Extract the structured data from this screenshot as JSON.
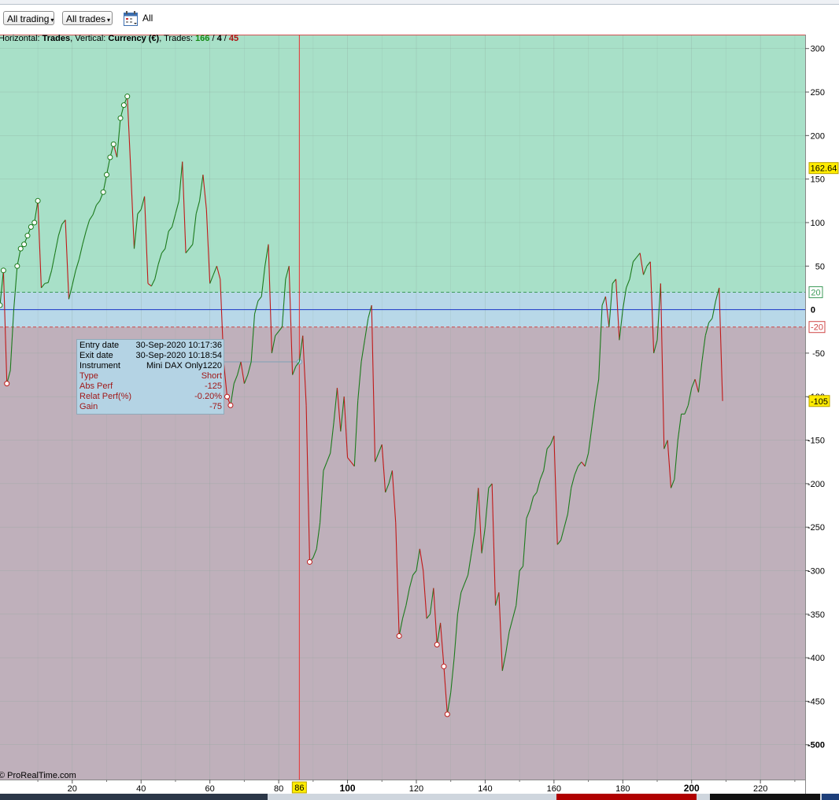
{
  "toolbar": {
    "trading_filter": "All trading",
    "trades_filter": "All trades",
    "period_label": "All"
  },
  "header": {
    "prefix": "Horizontal: ",
    "h_value": "Trades",
    "mid": ", Vertical: ",
    "v_value": "Currency (€)",
    "trades_label": ", Trades: ",
    "trades_win": "166",
    "sep1": " / ",
    "trades_flat": "4",
    "sep2": " / ",
    "trades_loss": "45"
  },
  "watermark": "© ProRealTime.com",
  "colors": {
    "profit_zone": "#a8e0c8",
    "neutral_zone": "#b8d8e8",
    "loss_zone": "#bfb0bb",
    "rising_segment": "#1c7a1c",
    "falling_segment": "#c01818",
    "cursor_line": "#e83030",
    "zero_line": "#1a35c8",
    "highlight_label": "#ffec00"
  },
  "chart_data": {
    "type": "line",
    "xlabel": "",
    "ylabel": "",
    "xlim": [
      -1,
      233
    ],
    "ylim": [
      -540,
      316
    ],
    "x_ticks": [
      20,
      40,
      60,
      80,
      100,
      120,
      140,
      160,
      180,
      200,
      220
    ],
    "x_ticks_bold": [
      100,
      200
    ],
    "y_ticks": [
      300,
      250,
      200,
      150,
      100,
      50,
      -50,
      -100,
      -150,
      -200,
      -250,
      -300,
      -350,
      -400,
      -450,
      -500
    ],
    "y_tick_zero": "0",
    "bands": {
      "upper": 20,
      "lower": -20,
      "upper_label": "20",
      "lower_label": "-20"
    },
    "last_value_label": "162.64",
    "last_value": 162.64,
    "current_value_label": "-105",
    "current_value": -105,
    "cursor_label": "86",
    "cursor_x": 86,
    "series": [
      {
        "values": [
          [
            -1,
            5
          ],
          [
            0,
            45
          ],
          [
            1,
            -85
          ],
          [
            2,
            -70
          ],
          [
            3,
            0
          ],
          [
            4,
            50
          ],
          [
            5,
            70
          ],
          [
            6,
            75
          ],
          [
            7,
            85
          ],
          [
            8,
            95
          ],
          [
            9,
            100
          ],
          [
            10,
            125
          ],
          [
            11,
            25
          ],
          [
            12,
            30
          ],
          [
            13,
            31
          ],
          [
            14,
            45
          ],
          [
            15,
            65
          ],
          [
            16,
            85
          ],
          [
            17,
            98
          ],
          [
            18,
            103
          ],
          [
            19,
            12
          ],
          [
            20,
            28
          ],
          [
            21,
            45
          ],
          [
            22,
            58
          ],
          [
            23,
            75
          ],
          [
            24,
            90
          ],
          [
            25,
            103
          ],
          [
            26,
            109
          ],
          [
            27,
            120
          ],
          [
            28,
            125
          ],
          [
            29,
            135
          ],
          [
            30,
            155
          ],
          [
            31,
            175
          ],
          [
            32,
            190
          ],
          [
            33,
            175
          ],
          [
            34,
            220
          ],
          [
            35,
            235
          ],
          [
            36,
            245
          ],
          [
            37,
            160
          ],
          [
            38,
            70
          ],
          [
            39,
            110
          ],
          [
            40,
            115
          ],
          [
            41,
            130
          ],
          [
            42,
            30
          ],
          [
            43,
            27
          ],
          [
            44,
            35
          ],
          [
            45,
            52
          ],
          [
            46,
            65
          ],
          [
            47,
            70
          ],
          [
            48,
            90
          ],
          [
            49,
            95
          ],
          [
            50,
            110
          ],
          [
            51,
            125
          ],
          [
            52,
            170
          ],
          [
            53,
            65
          ],
          [
            54,
            70
          ],
          [
            55,
            75
          ],
          [
            56,
            110
          ],
          [
            57,
            125
          ],
          [
            58,
            155
          ],
          [
            59,
            115
          ],
          [
            60,
            30
          ],
          [
            61,
            40
          ],
          [
            62,
            50
          ],
          [
            63,
            35
          ],
          [
            64,
            -60
          ],
          [
            65,
            -100
          ],
          [
            66,
            -110
          ],
          [
            67,
            -85
          ],
          [
            68,
            -75
          ],
          [
            69,
            -60
          ],
          [
            70,
            -85
          ],
          [
            71,
            -75
          ],
          [
            72,
            -60
          ],
          [
            73,
            -5
          ],
          [
            74,
            10
          ],
          [
            75,
            15
          ],
          [
            76,
            50
          ],
          [
            77,
            75
          ],
          [
            78,
            -50
          ],
          [
            79,
            -30
          ],
          [
            80,
            -25
          ],
          [
            81,
            -20
          ],
          [
            82,
            35
          ],
          [
            83,
            50
          ],
          [
            84,
            -75
          ],
          [
            85,
            -65
          ],
          [
            86,
            -60
          ],
          [
            87,
            -30
          ],
          [
            88,
            -110
          ],
          [
            89,
            -290
          ],
          [
            90,
            -285
          ],
          [
            91,
            -275
          ],
          [
            92,
            -245
          ],
          [
            93,
            -185
          ],
          [
            94,
            -175
          ],
          [
            95,
            -165
          ],
          [
            96,
            -130
          ],
          [
            97,
            -90
          ],
          [
            98,
            -140
          ],
          [
            99,
            -100
          ],
          [
            100,
            -170
          ],
          [
            101,
            -175
          ],
          [
            102,
            -180
          ],
          [
            103,
            -105
          ],
          [
            104,
            -60
          ],
          [
            105,
            -35
          ],
          [
            106,
            -10
          ],
          [
            107,
            5
          ],
          [
            108,
            -175
          ],
          [
            109,
            -165
          ],
          [
            110,
            -155
          ],
          [
            111,
            -210
          ],
          [
            112,
            -200
          ],
          [
            113,
            -185
          ],
          [
            114,
            -245
          ],
          [
            115,
            -375
          ],
          [
            116,
            -355
          ],
          [
            117,
            -340
          ],
          [
            118,
            -320
          ],
          [
            119,
            -305
          ],
          [
            120,
            -300
          ],
          [
            121,
            -275
          ],
          [
            122,
            -300
          ],
          [
            123,
            -355
          ],
          [
            124,
            -350
          ],
          [
            125,
            -320
          ],
          [
            126,
            -385
          ],
          [
            127,
            -360
          ],
          [
            128,
            -410
          ],
          [
            129,
            -465
          ],
          [
            130,
            -440
          ],
          [
            131,
            -400
          ],
          [
            132,
            -350
          ],
          [
            133,
            -325
          ],
          [
            134,
            -315
          ],
          [
            135,
            -305
          ],
          [
            136,
            -280
          ],
          [
            137,
            -255
          ],
          [
            138,
            -205
          ],
          [
            139,
            -280
          ],
          [
            140,
            -250
          ],
          [
            141,
            -205
          ],
          [
            142,
            -200
          ],
          [
            143,
            -340
          ],
          [
            144,
            -325
          ],
          [
            145,
            -415
          ],
          [
            146,
            -395
          ],
          [
            147,
            -370
          ],
          [
            148,
            -355
          ],
          [
            149,
            -340
          ],
          [
            150,
            -300
          ],
          [
            151,
            -295
          ],
          [
            152,
            -240
          ],
          [
            153,
            -230
          ],
          [
            154,
            -215
          ],
          [
            155,
            -210
          ],
          [
            156,
            -195
          ],
          [
            157,
            -185
          ],
          [
            158,
            -160
          ],
          [
            159,
            -155
          ],
          [
            160,
            -145
          ],
          [
            161,
            -270
          ],
          [
            162,
            -265
          ],
          [
            163,
            -250
          ],
          [
            164,
            -235
          ],
          [
            165,
            -205
          ],
          [
            166,
            -190
          ],
          [
            167,
            -180
          ],
          [
            168,
            -175
          ],
          [
            169,
            -180
          ],
          [
            170,
            -165
          ],
          [
            171,
            -135
          ],
          [
            172,
            -105
          ],
          [
            173,
            -80
          ],
          [
            174,
            5
          ],
          [
            175,
            15
          ],
          [
            176,
            -20
          ],
          [
            177,
            30
          ],
          [
            178,
            35
          ],
          [
            179,
            -35
          ],
          [
            180,
            0
          ],
          [
            181,
            25
          ],
          [
            182,
            35
          ],
          [
            183,
            55
          ],
          [
            184,
            60
          ],
          [
            185,
            65
          ],
          [
            186,
            40
          ],
          [
            187,
            50
          ],
          [
            188,
            55
          ],
          [
            189,
            -50
          ],
          [
            190,
            -35
          ],
          [
            191,
            30
          ],
          [
            192,
            -160
          ],
          [
            193,
            -150
          ],
          [
            194,
            -205
          ],
          [
            195,
            -195
          ],
          [
            196,
            -150
          ],
          [
            197,
            -120
          ],
          [
            198,
            -120
          ],
          [
            199,
            -110
          ],
          [
            200,
            -90
          ],
          [
            201,
            -80
          ],
          [
            202,
            -95
          ],
          [
            203,
            -60
          ],
          [
            204,
            -30
          ],
          [
            205,
            -15
          ],
          [
            206,
            -10
          ],
          [
            207,
            10
          ],
          [
            208,
            25
          ],
          [
            209,
            -105
          ]
        ]
      }
    ]
  }
}
